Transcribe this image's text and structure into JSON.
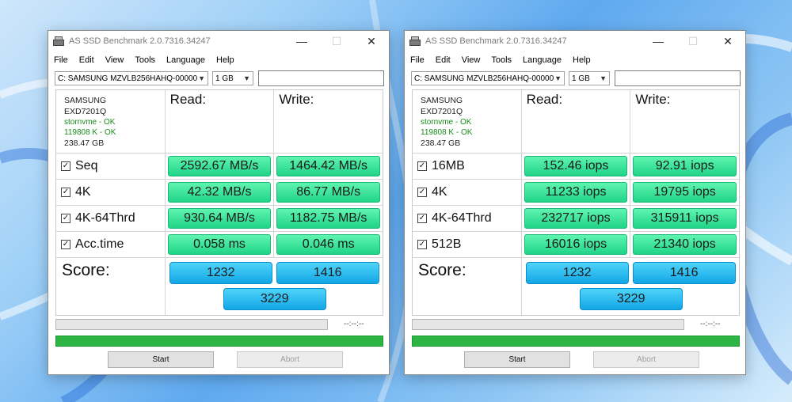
{
  "left_window": {
    "title": "AS SSD Benchmark 2.0.7316.34247",
    "menu": [
      "File",
      "Edit",
      "View",
      "Tools",
      "Language",
      "Help"
    ],
    "drive": "C: SAMSUNG MZVLB256HAHQ-00000",
    "size": "1 GB",
    "info": {
      "vendor": "SAMSUNG",
      "firmware": "EXD7201Q",
      "driver_status": "stornvme - OK",
      "align_status": "119808 K - OK",
      "capacity": "238.47 GB"
    },
    "read_header": "Read:",
    "write_header": "Write:",
    "rows": [
      {
        "label": "Seq",
        "read": "2592.67 MB/s",
        "write": "1464.42 MB/s"
      },
      {
        "label": "4K",
        "read": "42.32 MB/s",
        "write": "86.77 MB/s"
      },
      {
        "label": "4K-64Thrd",
        "read": "930.64 MB/s",
        "write": "1182.75 MB/s"
      },
      {
        "label": "Acc.time",
        "read": "0.058 ms",
        "write": "0.046 ms"
      }
    ],
    "score_label": "Score:",
    "score_read": "1232",
    "score_write": "1416",
    "score_total": "3229",
    "timer": "--:--:--",
    "progress": 1.0,
    "start_label": "Start",
    "abort_label": "Abort"
  },
  "right_window": {
    "title": "AS SSD Benchmark 2.0.7316.34247",
    "menu": [
      "File",
      "Edit",
      "View",
      "Tools",
      "Language",
      "Help"
    ],
    "drive": "C: SAMSUNG MZVLB256HAHQ-00000",
    "size": "1 GB",
    "info": {
      "vendor": "SAMSUNG",
      "firmware": "EXD7201Q",
      "driver_status": "stornvme - OK",
      "align_status": "119808 K - OK",
      "capacity": "238.47 GB"
    },
    "read_header": "Read:",
    "write_header": "Write:",
    "rows": [
      {
        "label": "16MB",
        "read": "152.46 iops",
        "write": "92.91 iops"
      },
      {
        "label": "4K",
        "read": "11233 iops",
        "write": "19795 iops"
      },
      {
        "label": "4K-64Thrd",
        "read": "232717 iops",
        "write": "315911 iops"
      },
      {
        "label": "512B",
        "read": "16016 iops",
        "write": "21340 iops"
      }
    ],
    "score_label": "Score:",
    "score_read": "1232",
    "score_write": "1416",
    "score_total": "3229",
    "timer": "--:--:--",
    "progress": 1.0,
    "start_label": "Start",
    "abort_label": "Abort"
  },
  "colors": {
    "result_green": "#2fe19a",
    "score_blue": "#22b4ef",
    "progress_green": "#2cb542",
    "ok_text": "#1a8a1a"
  },
  "icons": {
    "minimize": "minimize-icon",
    "maximize": "maximize-icon",
    "close": "close-icon",
    "check": "checkbox-checked-icon"
  }
}
